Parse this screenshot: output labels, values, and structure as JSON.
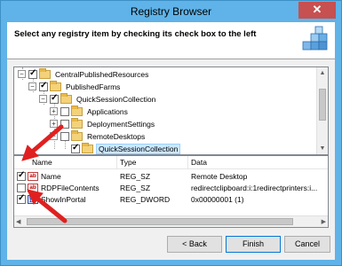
{
  "window": {
    "title": "Registry Browser",
    "close_glyph": "✕"
  },
  "header": {
    "instruction": "Select any registry item by checking its check box to the left"
  },
  "tree": {
    "items": [
      {
        "label": "CentralPublishedResources",
        "expander": "−",
        "checked": true
      },
      {
        "label": "PublishedFarms",
        "expander": "−",
        "checked": true
      },
      {
        "label": "QuickSessionCollection",
        "expander": "−",
        "checked": true
      },
      {
        "label": "Applications",
        "expander": "+",
        "checked": false
      },
      {
        "label": "DeploymentSettings",
        "expander": "+",
        "checked": false
      },
      {
        "label": "RemoteDesktops",
        "expander": "−",
        "checked": false
      },
      {
        "label": "QuickSessionCollection",
        "expander": "",
        "checked": true,
        "selected": true
      }
    ]
  },
  "list": {
    "columns": [
      "Name",
      "Type",
      "Data"
    ],
    "rows": [
      {
        "name": "Name",
        "type": "REG_SZ",
        "data": "Remote Desktop",
        "checked": true,
        "icon": "ab"
      },
      {
        "name": "RDPFileContents",
        "type": "REG_SZ",
        "data": "redirectclipboard:i:1redirectprinters:i...",
        "checked": false,
        "icon": "ab"
      },
      {
        "name": "ShowInPortal",
        "type": "REG_DWORD",
        "data": "0x00000001 (1)",
        "checked": true,
        "icon": "binary"
      }
    ]
  },
  "buttons": {
    "back": "< Back",
    "finish": "Finish",
    "cancel": "Cancel"
  },
  "colors": {
    "window_frame": "#5fb3e8",
    "annotation_arrow": "#e02020",
    "close_button": "#c75050"
  }
}
